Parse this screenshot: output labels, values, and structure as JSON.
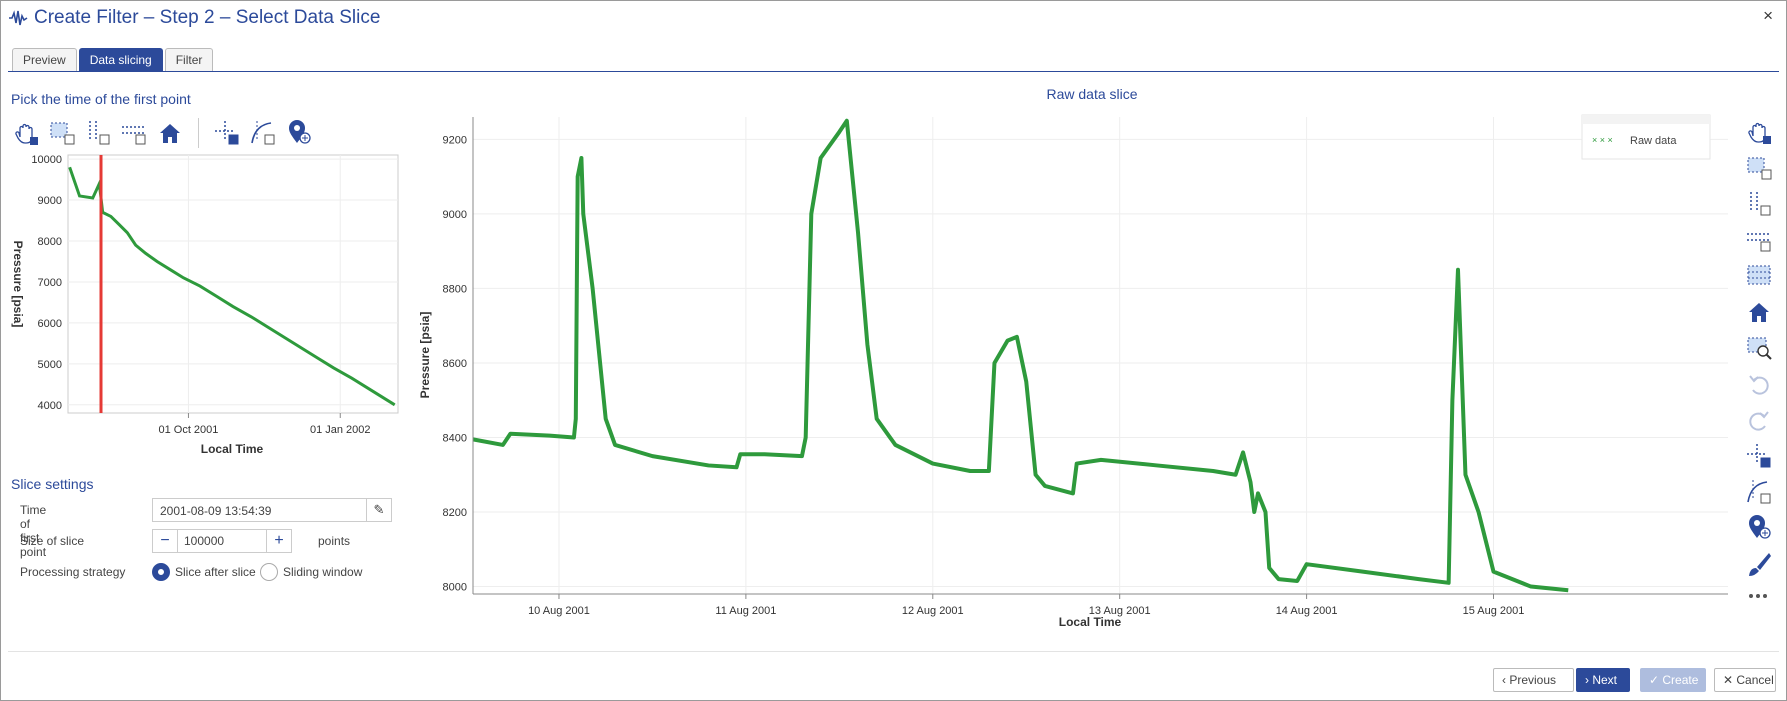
{
  "window": {
    "title": "Create Filter – Step 2 – Select Data Slice",
    "close_label": "×"
  },
  "tabs": [
    {
      "label": "Preview",
      "active": false
    },
    {
      "label": "Data slicing",
      "active": true
    },
    {
      "label": "Filter",
      "active": false
    }
  ],
  "left_panel": {
    "heading": "Pick the time of the first point"
  },
  "toolbar_left": [
    "pan-icon",
    "box-select-icon",
    "x-range-select-icon",
    "y-range-select-icon",
    "home-icon",
    "crosshair-select-icon",
    "curve-select-icon",
    "point-lookup-icon"
  ],
  "toolbar_right": [
    "pan-icon",
    "box-select-icon",
    "x-range-select-icon",
    "y-range-select-icon",
    "xy-range-select-icon",
    "home-icon",
    "zoom-icon",
    "undo-icon",
    "redo-icon",
    "crosshair-select-icon",
    "curve-select-icon",
    "point-lookup-icon",
    "brush-icon",
    "more-icon"
  ],
  "slice_settings": {
    "heading": "Slice settings",
    "time_label": "Time of first point",
    "time_value": "2001-08-09 13:54:39",
    "size_label": "Size of slice",
    "size_value": "100000",
    "size_unit": "points",
    "minus": "−",
    "plus": "+",
    "strategy_label": "Processing strategy",
    "strategy_options": [
      {
        "label": "Slice after slice",
        "selected": true
      },
      {
        "label": "Sliding window",
        "selected": false
      }
    ]
  },
  "footer": {
    "previous": "Previous",
    "next": "Next",
    "create": "Create",
    "cancel": "Cancel"
  },
  "colors": {
    "accent": "#2c4a9a",
    "series": "#2e9a3c",
    "marker_line": "#e53935"
  },
  "chart_data": [
    {
      "type": "scatter",
      "title": "",
      "xlabel": "Local Time",
      "ylabel": "Pressure [psia]",
      "x_ticks": [
        "01 Oct 2001",
        "01 Jan 2002"
      ],
      "y_ticks": [
        4000,
        5000,
        6000,
        7000,
        8000,
        9000,
        10000
      ],
      "ylim": [
        3800,
        10100
      ],
      "xlim": [
        "2001-07-20",
        "2002-02-05"
      ],
      "selected_time_marker": "2001-08-09",
      "series": [
        {
          "values": [
            [
              "2001-07-21",
              9800
            ],
            [
              "2001-07-27",
              9100
            ],
            [
              "2001-08-04",
              9050
            ],
            [
              "2001-08-08",
              9400
            ],
            [
              "2001-08-10",
              8700
            ],
            [
              "2001-08-15",
              8600
            ],
            [
              "2001-08-20",
              8400
            ],
            [
              "2001-08-25",
              8200
            ],
            [
              "2001-08-30",
              7900
            ],
            [
              "2001-09-05",
              7700
            ],
            [
              "2001-09-12",
              7500
            ],
            [
              "2001-09-20",
              7300
            ],
            [
              "2001-09-28",
              7100
            ],
            [
              "2001-10-08",
              6900
            ],
            [
              "2001-10-18",
              6650
            ],
            [
              "2001-10-28",
              6400
            ],
            [
              "2001-11-08",
              6150
            ],
            [
              "2001-11-18",
              5900
            ],
            [
              "2001-11-28",
              5650
            ],
            [
              "2001-12-08",
              5400
            ],
            [
              "2001-12-18",
              5150
            ],
            [
              "2001-12-28",
              4900
            ],
            [
              "2002-01-08",
              4650
            ],
            [
              "2002-01-18",
              4400
            ],
            [
              "2002-01-28",
              4150
            ],
            [
              "2002-02-03",
              4000
            ]
          ]
        }
      ]
    },
    {
      "type": "scatter",
      "title": "Raw data slice",
      "xlabel": "Local Time",
      "ylabel": "Pressure [psia]",
      "x_ticks": [
        "10 Aug 2001",
        "11 Aug 2001",
        "12 Aug 2001",
        "13 Aug 2001",
        "14 Aug 2001",
        "15 Aug 2001"
      ],
      "y_ticks": [
        8000,
        8200,
        8400,
        8600,
        8800,
        9000,
        9200
      ],
      "ylim": [
        7980,
        9260
      ],
      "xlim_days": [
        9.54,
        15.42
      ],
      "legend": {
        "position": "top-right",
        "entries": [
          "Raw data"
        ]
      },
      "series": [
        {
          "name": "Raw data",
          "values": [
            [
              9.54,
              8395
            ],
            [
              9.7,
              8380
            ],
            [
              9.74,
              8410
            ],
            [
              9.95,
              8405
            ],
            [
              10.08,
              8400
            ],
            [
              10.09,
              8450
            ],
            [
              10.1,
              9100
            ],
            [
              10.12,
              9150
            ],
            [
              10.13,
              9000
            ],
            [
              10.18,
              8800
            ],
            [
              10.22,
              8600
            ],
            [
              10.25,
              8450
            ],
            [
              10.3,
              8380
            ],
            [
              10.5,
              8350
            ],
            [
              10.8,
              8325
            ],
            [
              10.95,
              8320
            ],
            [
              10.97,
              8355
            ],
            [
              11.1,
              8355
            ],
            [
              11.3,
              8350
            ],
            [
              11.32,
              8400
            ],
            [
              11.35,
              9000
            ],
            [
              11.4,
              9150
            ],
            [
              11.5,
              9220
            ],
            [
              11.54,
              9250
            ],
            [
              11.57,
              9100
            ],
            [
              11.6,
              8950
            ],
            [
              11.65,
              8650
            ],
            [
              11.7,
              8450
            ],
            [
              11.8,
              8380
            ],
            [
              12.0,
              8330
            ],
            [
              12.2,
              8310
            ],
            [
              12.3,
              8310
            ],
            [
              12.33,
              8600
            ],
            [
              12.4,
              8660
            ],
            [
              12.45,
              8670
            ],
            [
              12.5,
              8550
            ],
            [
              12.55,
              8300
            ],
            [
              12.6,
              8270
            ],
            [
              12.75,
              8250
            ],
            [
              12.77,
              8330
            ],
            [
              12.9,
              8340
            ],
            [
              13.2,
              8325
            ],
            [
              13.5,
              8310
            ],
            [
              13.62,
              8300
            ],
            [
              13.66,
              8360
            ],
            [
              13.7,
              8280
            ],
            [
              13.72,
              8200
            ],
            [
              13.74,
              8250
            ],
            [
              13.78,
              8200
            ],
            [
              13.8,
              8050
            ],
            [
              13.85,
              8020
            ],
            [
              13.95,
              8015
            ],
            [
              14.0,
              8060
            ],
            [
              14.3,
              8040
            ],
            [
              14.6,
              8020
            ],
            [
              14.76,
              8010
            ],
            [
              14.78,
              8500
            ],
            [
              14.81,
              8850
            ],
            [
              14.85,
              8300
            ],
            [
              14.92,
              8200
            ],
            [
              15.0,
              8040
            ],
            [
              15.2,
              8000
            ],
            [
              15.4,
              7990
            ]
          ]
        }
      ]
    }
  ]
}
